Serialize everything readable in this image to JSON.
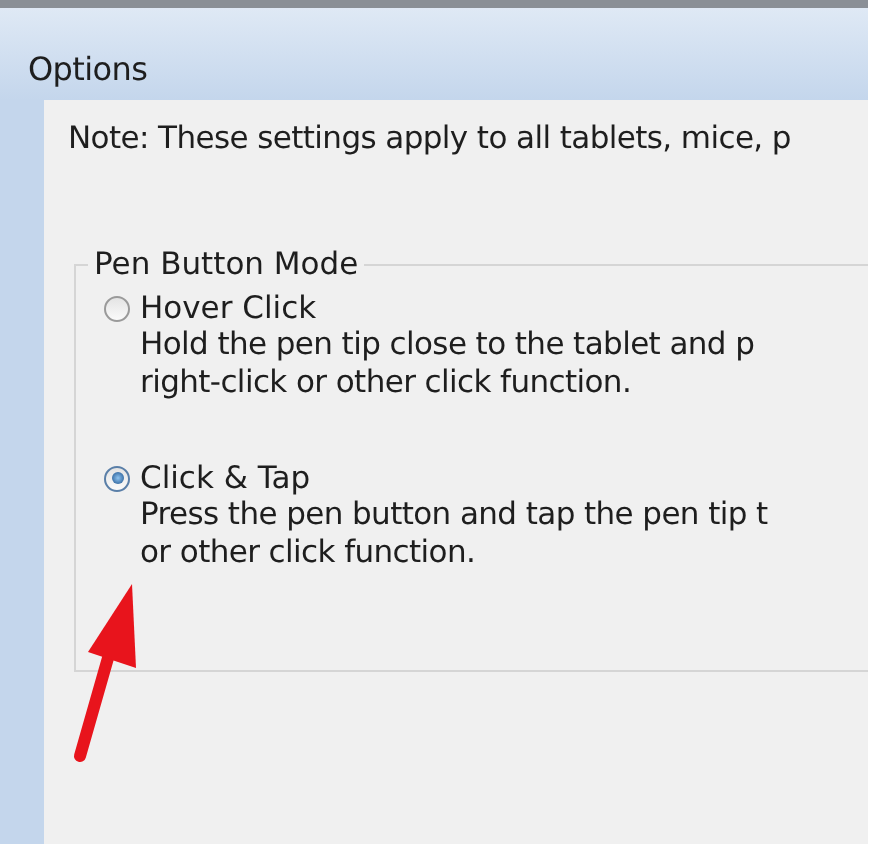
{
  "window": {
    "title": "Options"
  },
  "note": "Note: These settings apply to all tablets, mice, p",
  "group": {
    "title": "Pen Button Mode",
    "options": [
      {
        "label": "Hover Click",
        "selected": false,
        "description": [
          "Hold the pen tip close to the tablet and p",
          "right-click or other click function."
        ]
      },
      {
        "label": "Click & Tap",
        "selected": true,
        "description": [
          "Press the pen button and tap the pen tip t",
          "or other click function."
        ]
      }
    ]
  }
}
